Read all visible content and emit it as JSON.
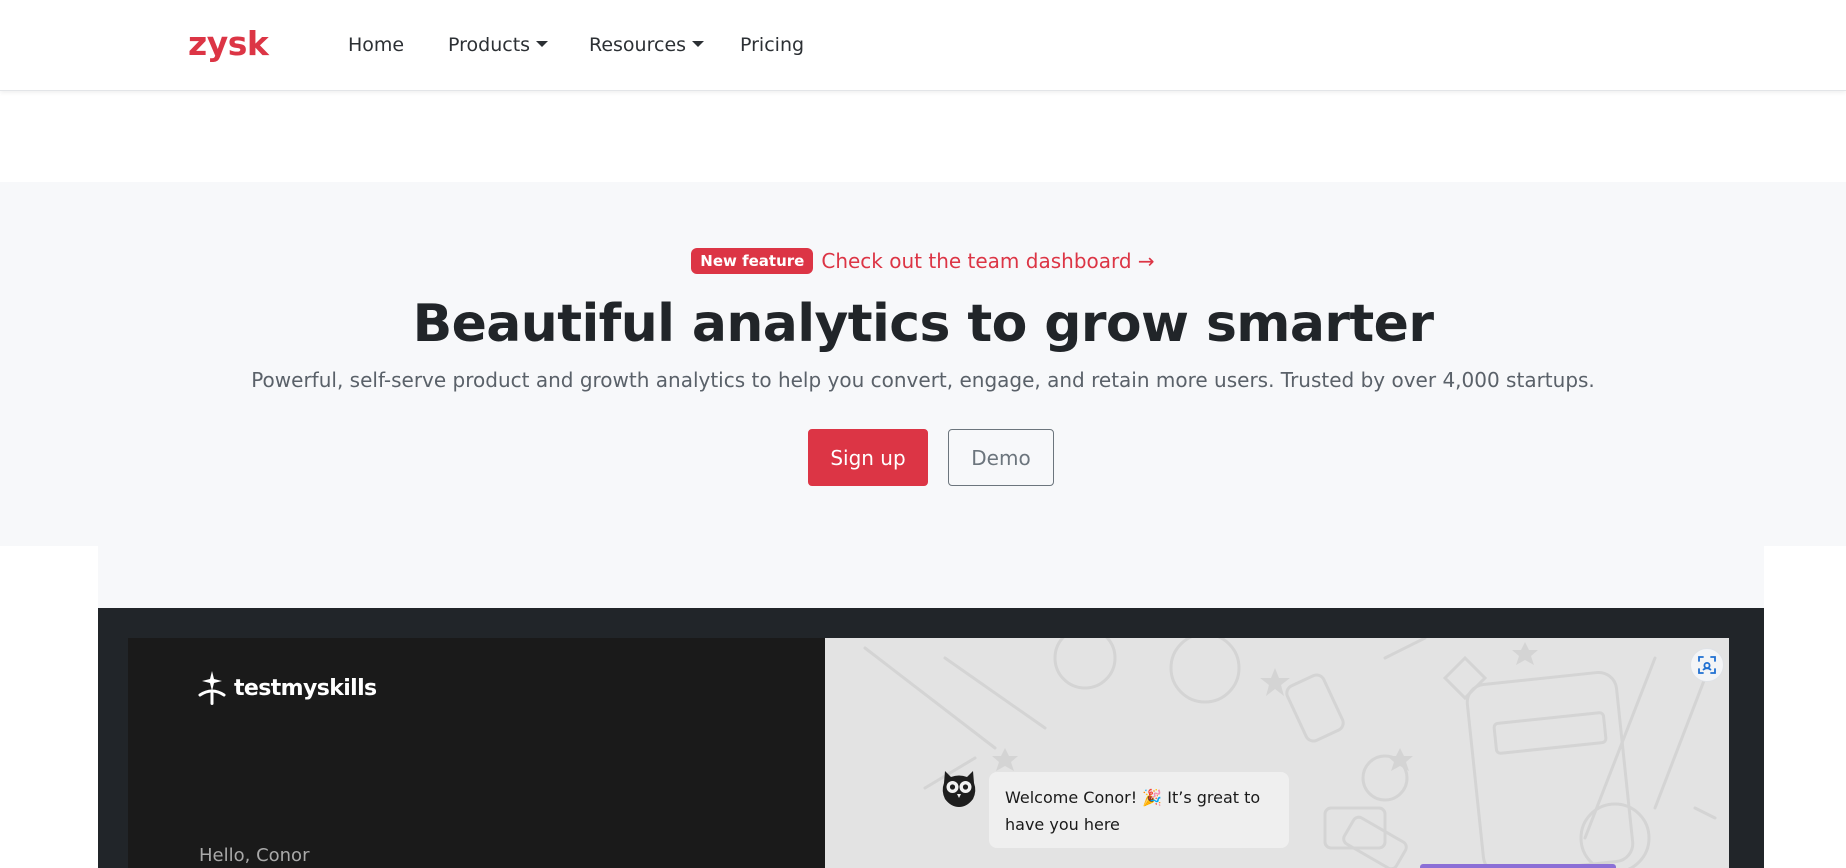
{
  "navbar": {
    "brand": "zysk",
    "links": [
      {
        "label": "Home",
        "dropdown": false
      },
      {
        "label": "Products",
        "dropdown": true
      },
      {
        "label": "Resources",
        "dropdown": true
      },
      {
        "label": "Pricing",
        "dropdown": false
      }
    ]
  },
  "hero": {
    "badge": "New feature",
    "announcement": "Check out the team dashboard →",
    "title": "Beautiful analytics to grow smarter",
    "subtitle": "Powerful, self-serve product and growth analytics to help you convert, engage, and retain more users. Trusted by over 4,000 startups.",
    "primary_button": "Sign up",
    "secondary_button": "Demo"
  },
  "preview": {
    "app_logo": "testmyskills",
    "greeting": "Hello, Conor",
    "chat_message": "Welcome Conor! 🎉 It’s great to have you here",
    "icons": {
      "logo": "spark-person-icon",
      "expand": "expand-scan-icon",
      "avatar": "owl-icon"
    }
  },
  "colors": {
    "brand": "#dc3545",
    "hero_bg": "#f7f8fa",
    "frame_bg": "#212529",
    "panel_dark": "#1a1a1a",
    "panel_light": "#e3e3e3",
    "accent_purple": "#8b6fd6"
  }
}
